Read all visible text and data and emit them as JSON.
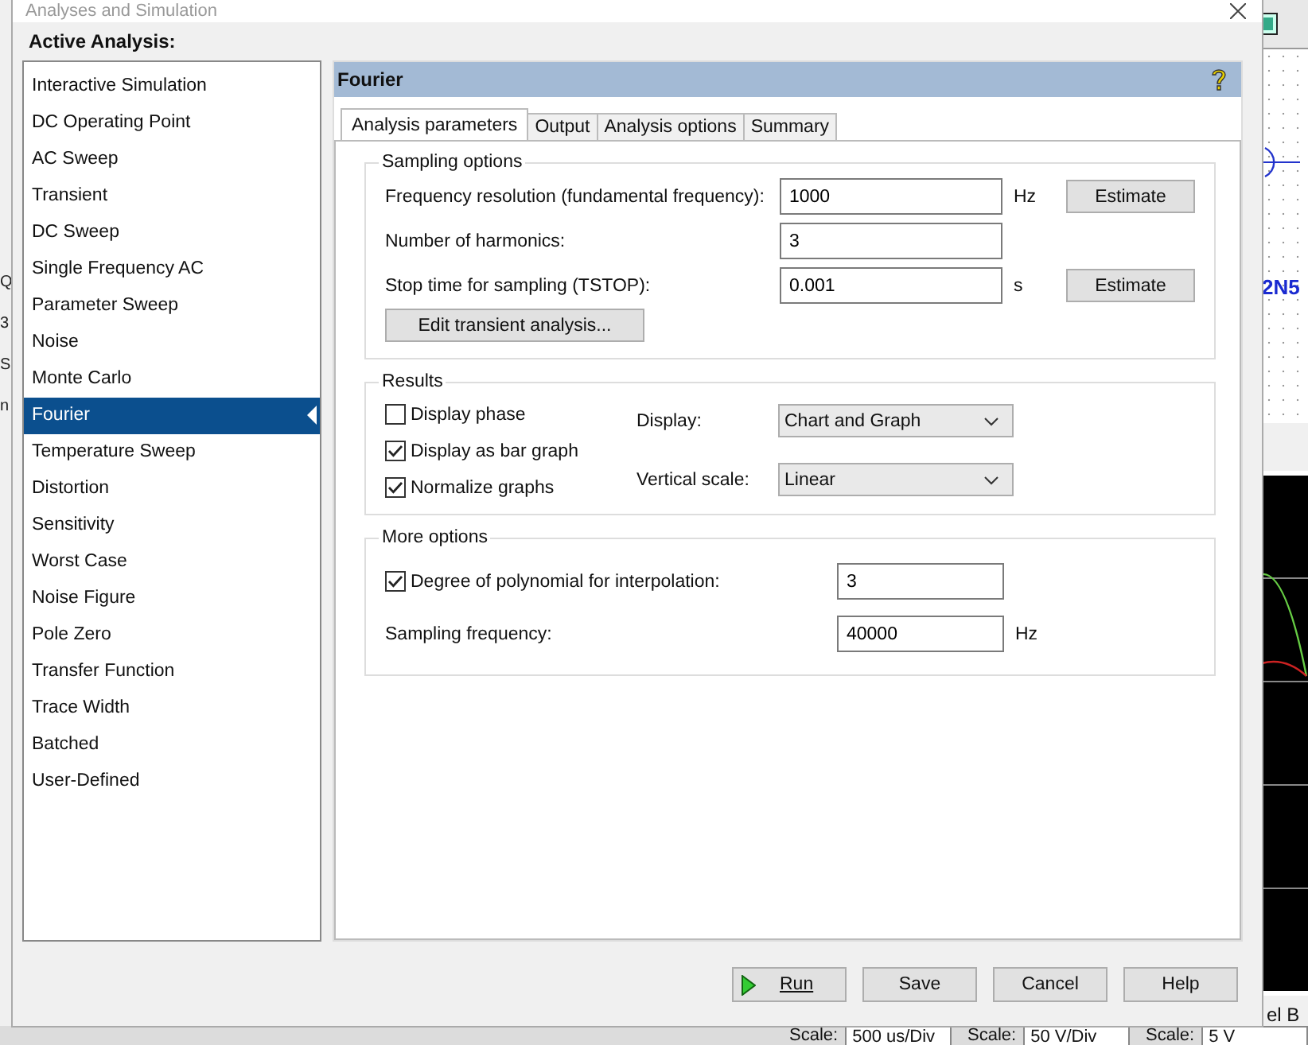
{
  "window": {
    "title": "Analyses and Simulation"
  },
  "active_analysis_label": "Active Analysis:",
  "analyses": [
    {
      "label": "Interactive Simulation",
      "selected": false
    },
    {
      "label": "DC Operating Point",
      "selected": false
    },
    {
      "label": "AC Sweep",
      "selected": false
    },
    {
      "label": "Transient",
      "selected": false
    },
    {
      "label": "DC Sweep",
      "selected": false
    },
    {
      "label": "Single Frequency AC",
      "selected": false
    },
    {
      "label": "Parameter Sweep",
      "selected": false
    },
    {
      "label": "Noise",
      "selected": false
    },
    {
      "label": "Monte Carlo",
      "selected": false
    },
    {
      "label": "Fourier",
      "selected": true
    },
    {
      "label": "Temperature Sweep",
      "selected": false
    },
    {
      "label": "Distortion",
      "selected": false
    },
    {
      "label": "Sensitivity",
      "selected": false
    },
    {
      "label": "Worst Case",
      "selected": false
    },
    {
      "label": "Noise Figure",
      "selected": false
    },
    {
      "label": "Pole Zero",
      "selected": false
    },
    {
      "label": "Transfer Function",
      "selected": false
    },
    {
      "label": "Trace Width",
      "selected": false
    },
    {
      "label": "Batched",
      "selected": false
    },
    {
      "label": "User-Defined",
      "selected": false
    }
  ],
  "panel": {
    "title": "Fourier"
  },
  "tabs": [
    {
      "label": "Analysis parameters",
      "selected": true
    },
    {
      "label": "Output",
      "selected": false
    },
    {
      "label": "Analysis options",
      "selected": false
    },
    {
      "label": "Summary",
      "selected": false
    }
  ],
  "sampling_options": {
    "title": "Sampling options",
    "rows": [
      {
        "label": "Frequency resolution (fundamental frequency):",
        "value": "1000",
        "unit": "Hz",
        "button": "Estimate"
      },
      {
        "label": "Number of harmonics:",
        "value": "3"
      },
      {
        "label": "Stop time for sampling (TSTOP):",
        "value": "0.001",
        "unit": "s",
        "button": "Estimate"
      }
    ],
    "edit_button": "Edit transient analysis..."
  },
  "results": {
    "title": "Results",
    "checkboxes": [
      {
        "label": "Display phase",
        "checked": false
      },
      {
        "label": "Display as bar graph",
        "checked": true
      },
      {
        "label": "Normalize graphs",
        "checked": true
      }
    ],
    "dropdowns": [
      {
        "label": "Display:",
        "value": "Chart and Graph"
      },
      {
        "label": "Vertical scale:",
        "value": "Linear"
      }
    ]
  },
  "more_options": {
    "title": "More options",
    "rows": [
      {
        "kind": "checkbox",
        "label": "Degree of polynomial for interpolation:",
        "checked": true,
        "value": "3"
      },
      {
        "kind": "plain",
        "label": "Sampling frequency:",
        "value": "40000",
        "unit": "Hz"
      }
    ]
  },
  "buttons": [
    {
      "label": "Run",
      "kind": "run"
    },
    {
      "label": "Save",
      "kind": "plain"
    },
    {
      "label": "Cancel",
      "kind": "plain"
    },
    {
      "label": "Help",
      "kind": "plain"
    }
  ],
  "background": {
    "left_edge": [
      "Q",
      "3",
      "S",
      "n"
    ],
    "part_label": "2N5",
    "channel_label": "el B",
    "scales": [
      {
        "label": "Scale:",
        "value": "500 us/Div"
      },
      {
        "label": "Scale:",
        "value": "50 V/Div"
      },
      {
        "label": "Scale:",
        "value": "5 V"
      }
    ]
  }
}
